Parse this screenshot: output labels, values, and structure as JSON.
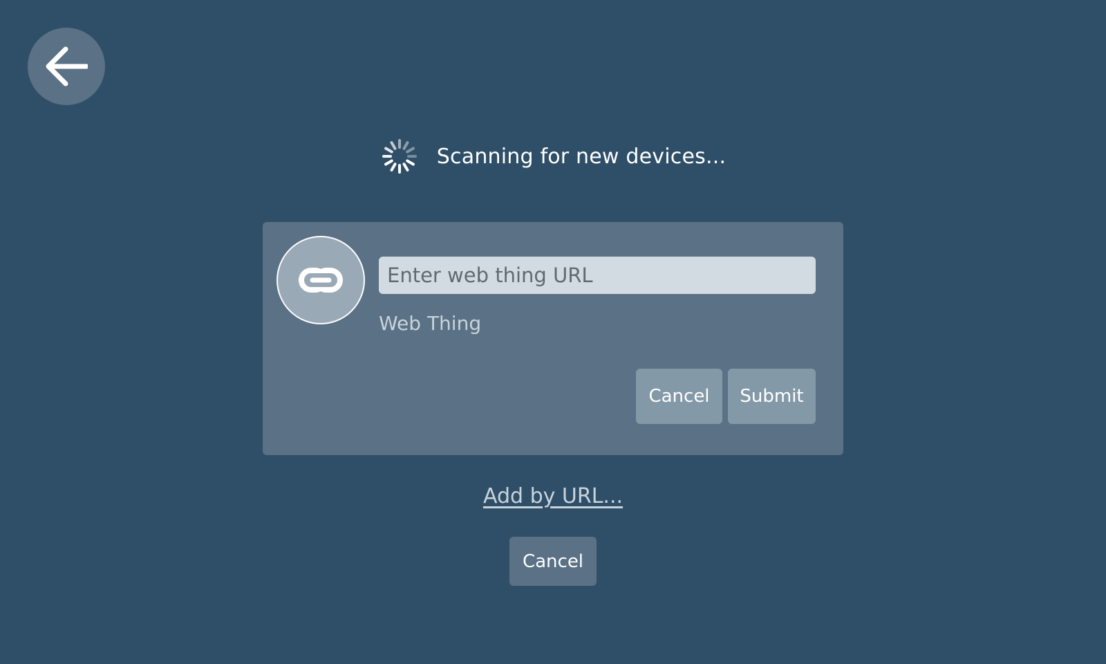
{
  "header": {
    "back_icon": "arrow-left-icon"
  },
  "scan": {
    "icon": "spinner-icon",
    "text": "Scanning for new devices..."
  },
  "add_by_url_card": {
    "icon": "link-icon",
    "url_input": {
      "value": "",
      "placeholder": "Enter web thing URL"
    },
    "thing_type": "Web Thing",
    "cancel_label": "Cancel",
    "submit_label": "Submit"
  },
  "add_by_url_link": "Add by URL...",
  "bottom": {
    "cancel_label": "Cancel"
  },
  "colors": {
    "background": "#2f4f68",
    "panel": "#5a7186",
    "button": "#8499a8",
    "input": "#d3dbe2"
  }
}
